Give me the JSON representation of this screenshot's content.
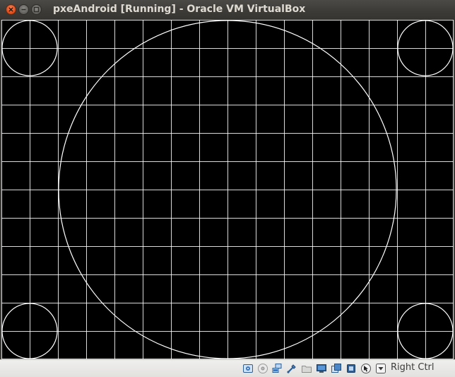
{
  "window": {
    "title": "pxeAndroid [Running] - Oracle VM VirtualBox"
  },
  "vm_display": {
    "content": "test-pattern grid",
    "background": "#000000",
    "line_color": "#ffffff",
    "grid_columns": 16,
    "grid_rows": 12
  },
  "status_bar": {
    "indicators": [
      {
        "icon": "hard-disk-icon"
      },
      {
        "icon": "optical-drive-icon"
      },
      {
        "icon": "network-icon"
      },
      {
        "icon": "usb-icon"
      },
      {
        "icon": "shared-folders-icon"
      },
      {
        "icon": "display-icon"
      },
      {
        "icon": "video-capture-icon"
      },
      {
        "icon": "cpu-icon"
      },
      {
        "icon": "mouse-integration-icon"
      },
      {
        "icon": "keyboard-capture-icon"
      }
    ],
    "host_key": "Right Ctrl"
  }
}
